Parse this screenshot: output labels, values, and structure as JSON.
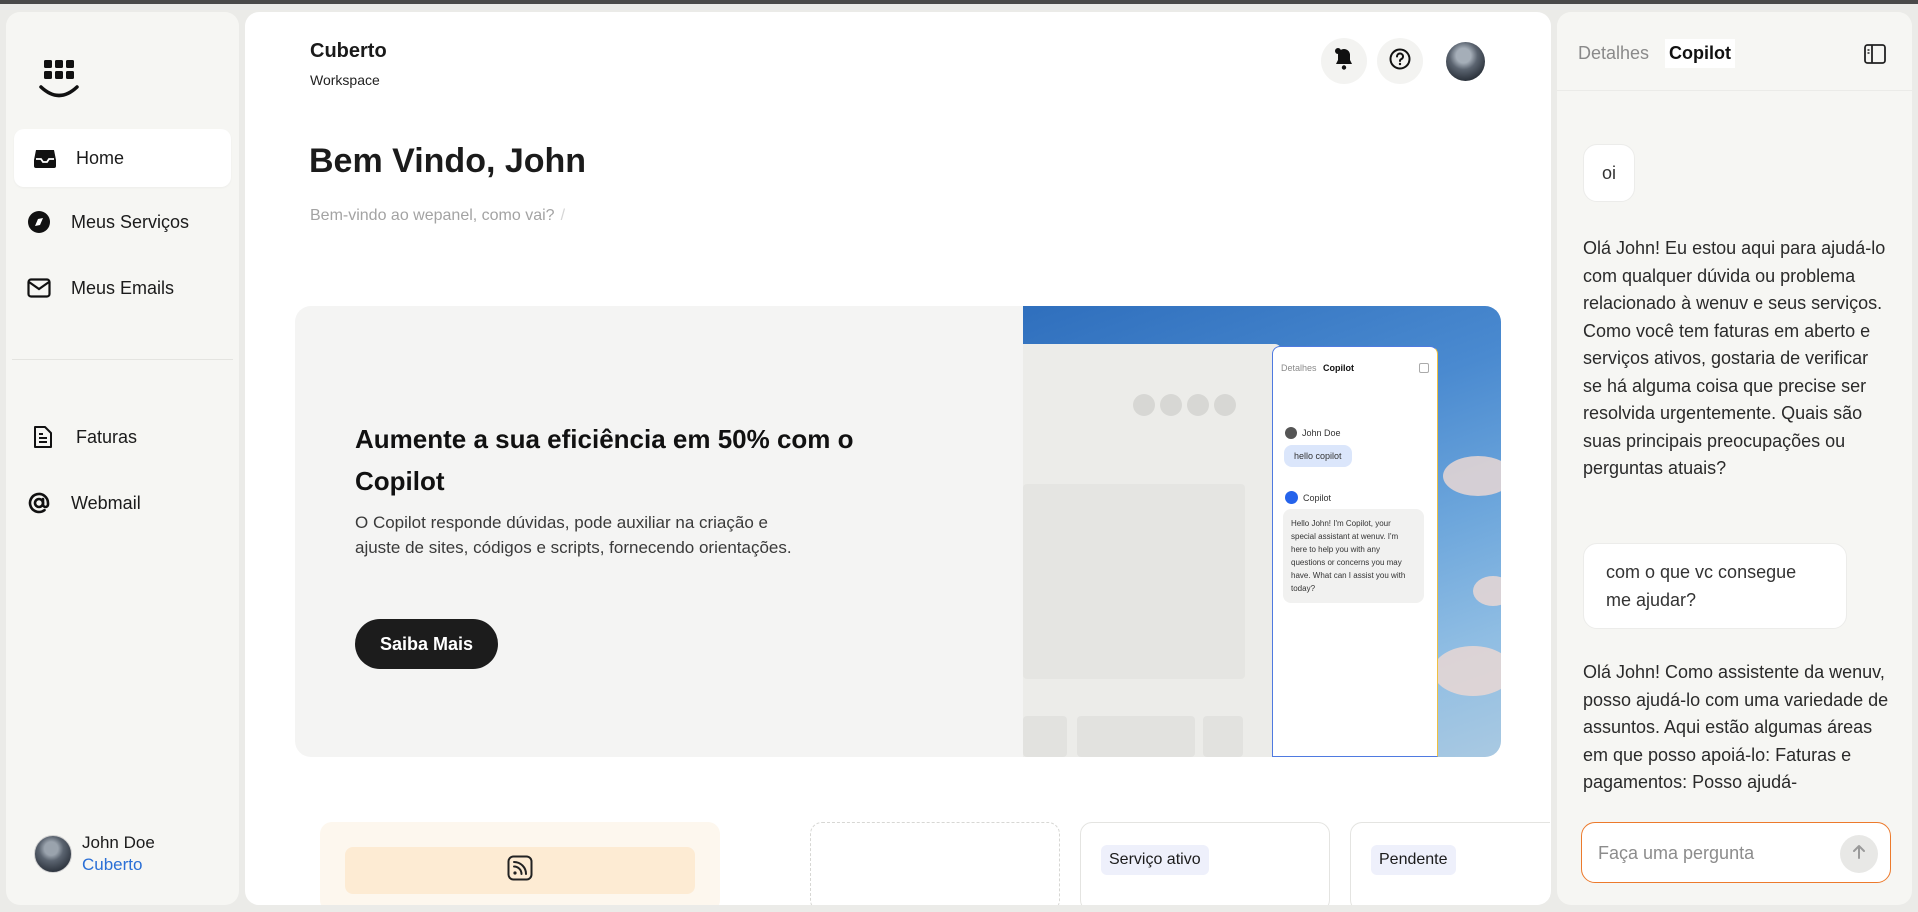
{
  "sidebar": {
    "logo_icon": "grid-smile-logo",
    "items": [
      {
        "label": "Home",
        "icon": "inbox-icon",
        "active": true
      },
      {
        "label": "Meus Serviços",
        "icon": "compass-icon"
      },
      {
        "label": "Meus Emails",
        "icon": "mail-icon"
      },
      {
        "label": "Faturas",
        "icon": "document-icon"
      },
      {
        "label": "Webmail",
        "icon": "at-sign-icon"
      }
    ],
    "user": {
      "name": "John Doe",
      "org": "Cuberto"
    }
  },
  "header": {
    "workspace_title": "Cuberto",
    "workspace_sub": "Workspace",
    "icons": [
      "bell-icon",
      "help-icon",
      "avatar"
    ]
  },
  "main": {
    "welcome_title": "Bem Vindo, John",
    "welcome_sub": "Bem-vindo ao wepanel, como vai?",
    "welcome_sub_sep": "/",
    "hero": {
      "title": "Aumente a sua eficiência em 50% com o Copilot",
      "description": "O Copilot responde dúvidas, pode auxiliar na criação e ajuste de sites, códigos e scripts, fornecendo orientações.",
      "button": "Saiba Mais",
      "mock": {
        "tab_details": "Detalhes",
        "tab_copilot": "Copilot",
        "user_name": "John Doe",
        "user_msg": "hello copilot",
        "bot_name": "Copilot",
        "bot_msg": "Hello John! I'm Copilot, your special assistant at wenuv. I'm here to help you with any questions or concerns you may have. What can I assist you with today?"
      }
    },
    "cards": {
      "card_icon": "rss-icon",
      "status_active": "Serviço ativo",
      "status_pending": "Pendente"
    }
  },
  "copilot": {
    "tab_details": "Detalhes",
    "tab_copilot": "Copilot",
    "toggle_icon": "panel-left-icon",
    "messages": [
      {
        "role": "user",
        "text": "oi"
      },
      {
        "role": "bot",
        "text": "Olá John! Eu estou aqui para ajudá-lo com qualquer dúvida ou problema relacionado à wenuv e seus serviços. Como você tem faturas em aberto e serviços ativos, gostaria de verificar se há alguma coisa que precise ser resolvida urgentemente. Quais são suas principais preocupações ou perguntas atuais?"
      },
      {
        "role": "user",
        "text": "com o que vc consegue me ajudar?"
      },
      {
        "role": "bot",
        "text": "Olá John! Como assistente da wenuv, posso ajudá-lo com uma variedade de assuntos. Aqui estão algumas áreas em que posso apoiá-lo: Faturas e pagamentos: Posso ajudá-"
      }
    ],
    "input_placeholder": "Faça uma pergunta",
    "send_icon": "arrow-up-icon"
  },
  "colors": {
    "accent_orange": "#ec7a2c",
    "link_blue": "#2a6fd6",
    "dark_button": "#1c1c1c"
  }
}
